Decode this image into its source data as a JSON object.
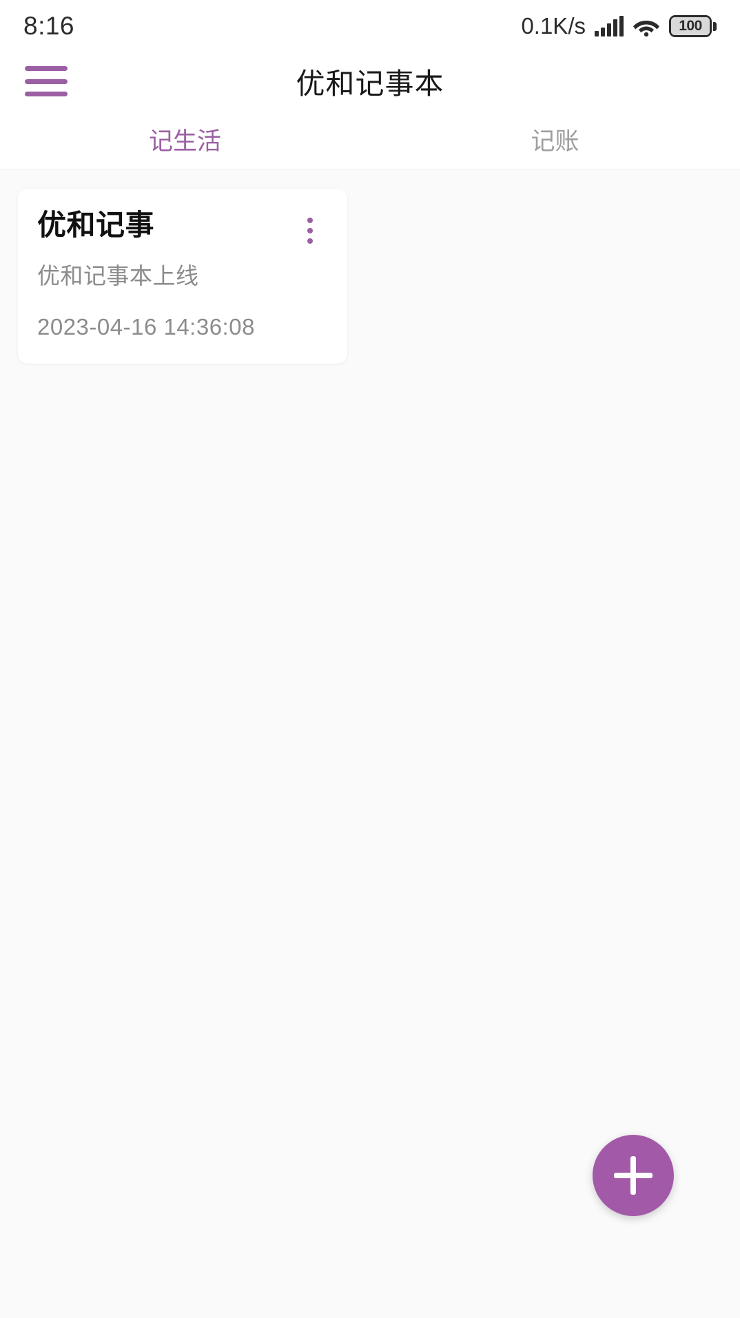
{
  "status_bar": {
    "time": "8:16",
    "network_speed": "0.1K/s",
    "signal_icon": "signal-bars-icon",
    "signal_bars": 5,
    "wifi_icon": "wifi-icon",
    "battery_level": "100",
    "battery_icon": "battery-icon"
  },
  "app_bar": {
    "menu_icon": "hamburger-menu-icon",
    "title": "优和记事本",
    "accent_color": "#9b5fa3"
  },
  "tabs": [
    {
      "label": "记生活",
      "active": true
    },
    {
      "label": "记账",
      "active": false
    }
  ],
  "notes": [
    {
      "title": "优和记事",
      "subtitle": "优和记事本上线",
      "timestamp": "2023-04-16 14:36:08",
      "menu_icon": "more-vertical-icon"
    }
  ],
  "fab": {
    "icon": "plus-icon",
    "color": "#a25aa8"
  }
}
